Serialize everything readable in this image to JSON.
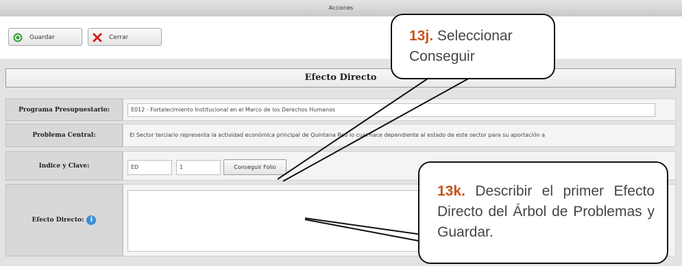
{
  "window": {
    "title": "Acciones"
  },
  "toolbar": {
    "save_label": "Guardar",
    "close_label": "Cerrar"
  },
  "form": {
    "header": "Efecto Directo",
    "programa_label": "Programa Presupuestario:",
    "programa_value": "E012 - Fortalecimiento Institucional en el Marco de los Derechos Humanos",
    "problema_label": "Problema Central:",
    "problema_value": "El Sector terciario representa la actividad económica principal de Quintana Roo lo cual hace dependiente al estado de este sector para su aportación a",
    "indice_label": "Indice y Clave:",
    "indice_value": "ED",
    "clave_value": "1",
    "conseguir_label": "Conseguir Folio",
    "efecto_label": "Efecto Directo:",
    "efecto_value": ""
  },
  "callouts": {
    "c1_num": "13j.",
    "c1_text": "Seleccionar Conseguir",
    "c2_num": "13k.",
    "c2_text": "Describir el primer Efecto Directo del Árbol de Problemas y Guardar."
  },
  "colors": {
    "accent": "#c5551a",
    "info": "#3c8fd6"
  }
}
